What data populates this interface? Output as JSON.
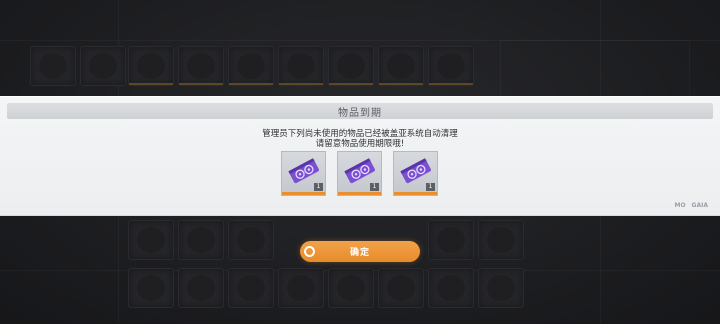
{
  "modal": {
    "title": "物品到期",
    "message_line1": "管理员下列尚未使用的物品已经被盖亚系统自动清理",
    "message_line2": "请留意物品使用期限哦!",
    "items": [
      {
        "icon": "purple-gpu-card-icon",
        "quantity": "1"
      },
      {
        "icon": "purple-gpu-card-icon",
        "quantity": "1"
      },
      {
        "icon": "purple-gpu-card-icon",
        "quantity": "1"
      }
    ],
    "corner_logos": [
      "MO",
      "GAIA"
    ]
  },
  "confirm_button": {
    "label": "确定"
  },
  "colors": {
    "accent": "#e88b2a",
    "item_purple": "#7a4fd1",
    "modal_bg": "#eceef0"
  }
}
